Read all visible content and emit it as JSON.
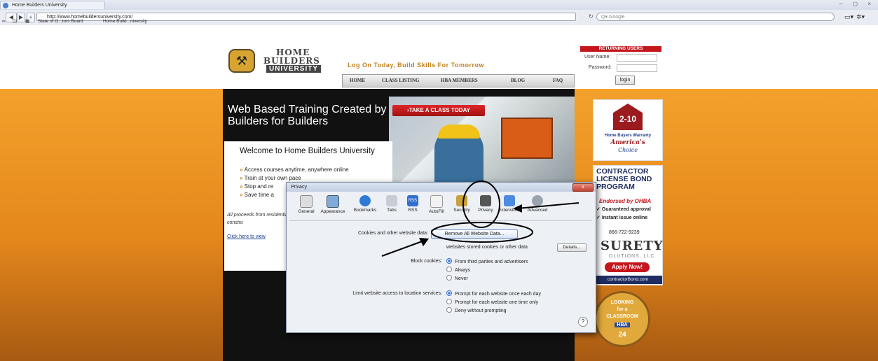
{
  "browser": {
    "tab_title": "Home Builders University",
    "url": "http://www.homebuildersuniversity.com/",
    "search_placeholder": "Google",
    "window_controls": "– ▢ ×",
    "bookmarks": [
      "State of O...tors Board",
      "Home Build...niversity"
    ]
  },
  "site": {
    "logo": {
      "line1": "HOME",
      "line2": "BUILDERS",
      "line3": "UNIVERSITY"
    },
    "tagline": "Log On Today, Build Skills For Tomorrow",
    "nav": [
      "HOME",
      "CLASS LISTING",
      "HBA MEMBERS",
      "BLOG",
      "FAQ"
    ],
    "login": {
      "header": "RETURNING USERS",
      "username_label": "User Name:",
      "password_label": "Password:",
      "button": "login"
    },
    "hero": {
      "headline": "Web Based Training Created by Builders for Builders",
      "cta": "›TAKE A CLASS TODAY"
    },
    "welcome": "Welcome to Home Builders University",
    "bullets": [
      "Access courses anytime, anywhere online",
      "Train at your own pace",
      "Stop and re",
      "Save time a"
    ],
    "proceeds": "All proceeds from residential constru",
    "click_link": "Click here to view"
  },
  "ads": {
    "warranty": {
      "number": "2-10",
      "line1": "Home Buyers Warranty",
      "line2": "America's",
      "line3": "Choice"
    },
    "bond": {
      "heading": "CONTRACTOR LICENSE BOND PROGRAM",
      "endorsed": "Endorsed by OHBA",
      "check1": "Guaranteed approval",
      "check2": "Instant issue online",
      "phone": "866-722-9239",
      "logo": "SURETY",
      "solutions": "OLUTIONS, LLC",
      "apply": "Apply Now!",
      "url": "contractorBond.com"
    },
    "classroom": {
      "line1": "LOOKING",
      "line2": "for a",
      "line3": "CLASSROOM",
      "badge": "HBA",
      "num": "24"
    }
  },
  "dialog": {
    "title": "Privacy",
    "close": "x",
    "tabs": [
      {
        "label": "General",
        "icon": "general-icon"
      },
      {
        "label": "Appearance",
        "icon": "appearance-icon"
      },
      {
        "label": "Bookmarks",
        "icon": "bookmarks-icon"
      },
      {
        "label": "Tabs",
        "icon": "tabs-icon"
      },
      {
        "label": "RSS",
        "icon": "rss-icon"
      },
      {
        "label": "AutoFill",
        "icon": "autofill-icon"
      },
      {
        "label": "Security",
        "icon": "lock-icon"
      },
      {
        "label": "Privacy",
        "icon": "privacy-icon"
      },
      {
        "label": "Extensions",
        "icon": "extensions-icon"
      },
      {
        "label": "Advanced",
        "icon": "gear-icon"
      }
    ],
    "cookies_label": "Cookies and other website data:",
    "remove_button": "Remove All Website Data...",
    "stored_text": "websites stored cookies or other data",
    "details_button": "Details...",
    "block_label": "Block cookies:",
    "block_options": [
      "From third parties and advertisers",
      "Always",
      "Never"
    ],
    "block_selected": 0,
    "location_label": "Limit website access to location services:",
    "location_options": [
      "Prompt for each website once each day",
      "Prompt for each website one time only",
      "Deny without prompting"
    ],
    "location_selected": 0,
    "help": "?"
  }
}
